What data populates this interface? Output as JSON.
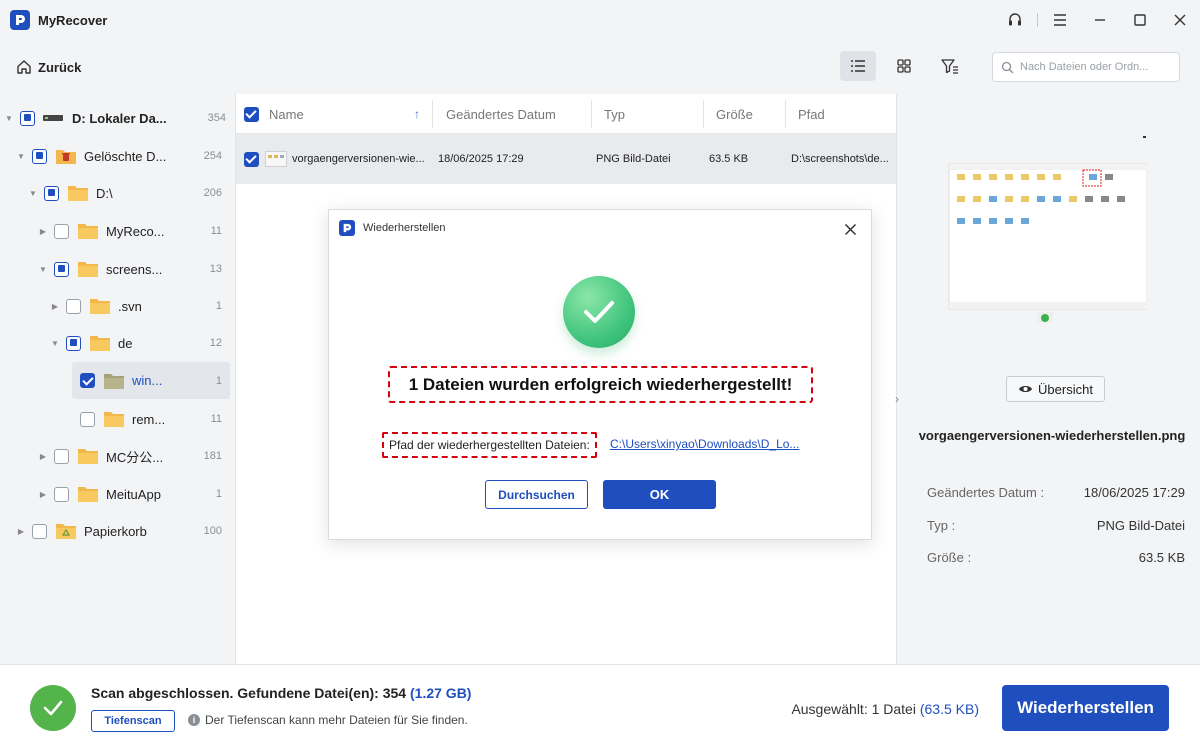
{
  "app": {
    "title": "MyRecover",
    "logo_icon": "myrecover-logo-icon",
    "accent_color": "#1f4fbf"
  },
  "window_controls": [
    "headset-icon",
    "menu-icon",
    "minimize-icon",
    "maximize-icon",
    "close-icon"
  ],
  "toolbar": {
    "back_label": "Zurück",
    "views": [
      "list-view-icon",
      "grid-view-icon",
      "filter-icon"
    ],
    "active_view": "list-view-icon",
    "search_placeholder": "Nach Dateien oder Ordn..."
  },
  "tree": {
    "items": [
      {
        "label": "D: Lokaler Da...",
        "count": "354",
        "state": "partial",
        "icon": "drive-icon",
        "expanded": true
      },
      {
        "label": "Gelöschte D...",
        "count": "254",
        "state": "partial",
        "icon": "deleted-folder-icon",
        "expanded": true
      },
      {
        "label": "D:\\",
        "count": "206",
        "state": "partial",
        "icon": "folder-icon",
        "expanded": true
      },
      {
        "label": "MyReco...",
        "count": "11",
        "state": "unchecked",
        "icon": "folder-icon",
        "expanded": false
      },
      {
        "label": "screens...",
        "count": "13",
        "state": "partial",
        "icon": "folder-icon",
        "expanded": true
      },
      {
        "label": ".svn",
        "count": "1",
        "state": "unchecked",
        "icon": "folder-icon",
        "expanded": false
      },
      {
        "label": "de",
        "count": "12",
        "state": "partial",
        "icon": "folder-icon",
        "expanded": true
      },
      {
        "label": "win...",
        "count": "1",
        "state": "checked",
        "icon": "folder-icon",
        "selected": true
      },
      {
        "label": "rem...",
        "count": "11",
        "state": "unchecked",
        "icon": "folder-icon"
      },
      {
        "label": "MC分公...",
        "count": "181",
        "state": "unchecked",
        "icon": "folder-icon",
        "expanded": false
      },
      {
        "label": "MeituApp",
        "count": "1",
        "state": "unchecked",
        "icon": "folder-icon",
        "expanded": false
      },
      {
        "label": "Papierkorb",
        "count": "100",
        "state": "unchecked",
        "icon": "recycle-bin-icon",
        "expanded": false
      }
    ]
  },
  "file_list": {
    "columns": [
      "Name",
      "Geändertes Datum",
      "Typ",
      "Größe",
      "Pfad"
    ],
    "rows": [
      {
        "name": "vorgaengerversionen-wie...",
        "date": "18/06/2025 17:29",
        "type": "PNG Bild-Datei",
        "size": "63.5 KB",
        "path": "D:\\screenshots\\de..."
      }
    ]
  },
  "preview": {
    "overview_label": "Übersicht",
    "file_name": "vorgaengerversionen-wiederherstellen.png",
    "meta": [
      {
        "label": "Geändertes Datum :",
        "value": "18/06/2025 17:29"
      },
      {
        "label": "Typ :",
        "value": "PNG Bild-Datei"
      },
      {
        "label": "Größe :",
        "value": "63.5 KB"
      }
    ]
  },
  "dialog": {
    "title": "Wiederherstellen",
    "message": "1 Dateien wurden erfolgreich wiederhergestellt!",
    "path_label": "Pfad der wiederhergestellten Dateien:",
    "path_link": "C:\\Users\\xinyao\\Downloads\\D_Lo...",
    "browse_label": "Durchsuchen",
    "ok_label": "OK",
    "highlight_color": "#d6000f",
    "success_color": "#3cc27b"
  },
  "bottom": {
    "scan_text": "Scan abgeschlossen. Gefundene Datei(en): 354",
    "scan_size": "(1.27 GB)",
    "deep_scan_label": "Tiefenscan",
    "deep_scan_hint": "Der Tiefenscan kann mehr Dateien für Sie finden.",
    "selected_text": "Ausgewählt: 1 Datei",
    "selected_size": "(63.5 KB)",
    "recover_label": "Wiederherstellen"
  }
}
